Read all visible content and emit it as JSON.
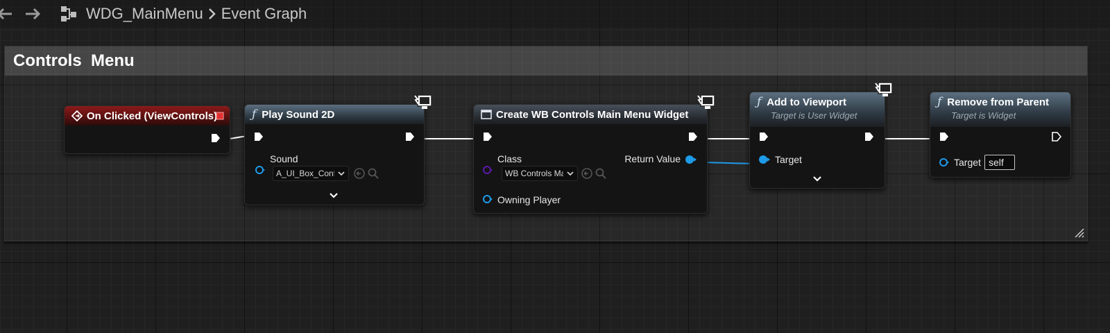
{
  "breadcrumb": {
    "blueprint": "WDG_MainMenu",
    "graph": "Event Graph"
  },
  "comment": {
    "title": "Controls  Menu"
  },
  "nodes": {
    "on_clicked": {
      "title": "On Clicked (ViewControls)"
    },
    "play_sound": {
      "title": "Play Sound 2D",
      "sound_label": "Sound",
      "sound_value": "A_UI_Box_Confi"
    },
    "create_widget": {
      "title": "Create WB Controls Main Menu Widget",
      "class_label": "Class",
      "class_value": "WB Controls Ma",
      "owning_player_label": "Owning Player",
      "return_label": "Return Value"
    },
    "add_viewport": {
      "title": "Add to Viewport",
      "subtitle": "Target is User Widget",
      "target_label": "Target"
    },
    "remove_parent": {
      "title": "Remove from Parent",
      "subtitle": "Target is Widget",
      "target_label": "Target",
      "target_value": "self"
    }
  },
  "colors": {
    "exec": "#ffffff",
    "object_pin": "#1e9be8",
    "class_pin": "#5a1aa8",
    "event_header": "#8c1a1a",
    "function_header": "#5c6f80"
  }
}
